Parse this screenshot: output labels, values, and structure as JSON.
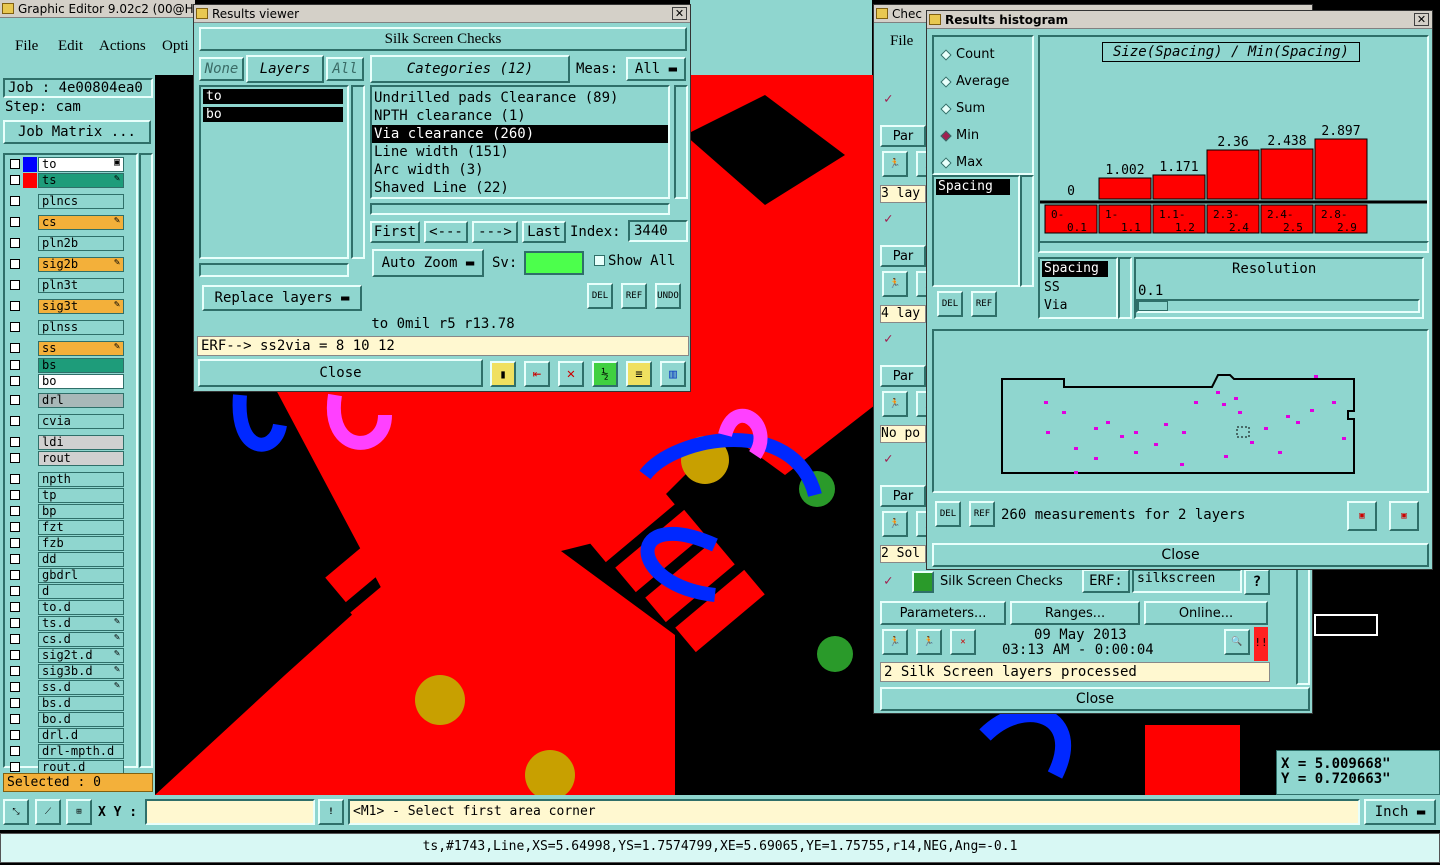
{
  "main_window": {
    "title": "Graphic Editor 9.02c2 (00@HY-",
    "menu": [
      "File",
      "Edit",
      "Actions",
      "Opti"
    ],
    "job_label": "Job : 4e00804ea0",
    "step_label": "Step: cam",
    "job_matrix_button": "Job Matrix ...",
    "selected_label": "Selected : 0",
    "layers": [
      {
        "name": "to",
        "color": "#ffffff",
        "swatch": "#0000ff",
        "mark": "▣"
      },
      {
        "name": "ts",
        "color": "#1e9c7a",
        "swatch": "#ff0000",
        "mark": "✎"
      },
      {
        "name": "plncs",
        "color": "#8fd6cf",
        "swatch": "",
        "mark": ""
      },
      {
        "name": "cs",
        "color": "#f3b03a",
        "swatch": "",
        "mark": "✎"
      },
      {
        "name": "pln2b",
        "color": "#8fd6cf",
        "swatch": "",
        "mark": ""
      },
      {
        "name": "sig2b",
        "color": "#f3b03a",
        "swatch": "",
        "mark": "✎"
      },
      {
        "name": "pln3t",
        "color": "#8fd6cf",
        "swatch": "",
        "mark": ""
      },
      {
        "name": "sig3t",
        "color": "#f3b03a",
        "swatch": "",
        "mark": "✎"
      },
      {
        "name": "plnss",
        "color": "#8fd6cf",
        "swatch": "",
        "mark": ""
      },
      {
        "name": "ss",
        "color": "#f3b03a",
        "swatch": "",
        "mark": "✎"
      },
      {
        "name": "bs",
        "color": "#1e9c7a",
        "swatch": "",
        "mark": ""
      },
      {
        "name": "bo",
        "color": "#ffffff",
        "swatch": "",
        "mark": ""
      },
      {
        "name": "drl",
        "color": "#a8b8b8",
        "swatch": "",
        "mark": ""
      },
      {
        "name": "cvia",
        "color": "#8fd6cf",
        "swatch": "",
        "mark": ""
      },
      {
        "name": "ldi",
        "color": "#d0d0d0",
        "swatch": "",
        "mark": ""
      },
      {
        "name": "rout",
        "color": "#d0d0d0",
        "swatch": "",
        "mark": ""
      },
      {
        "name": "npth",
        "color": "#8fd6cf",
        "swatch": "",
        "mark": ""
      },
      {
        "name": "tp",
        "color": "#8fd6cf",
        "swatch": "",
        "mark": ""
      },
      {
        "name": "bp",
        "color": "#8fd6cf",
        "swatch": "",
        "mark": ""
      },
      {
        "name": "fzt",
        "color": "#8fd6cf",
        "swatch": "",
        "mark": ""
      },
      {
        "name": "fzb",
        "color": "#8fd6cf",
        "swatch": "",
        "mark": ""
      },
      {
        "name": "dd",
        "color": "#8fd6cf",
        "swatch": "",
        "mark": ""
      },
      {
        "name": "gbdrl",
        "color": "#8fd6cf",
        "swatch": "",
        "mark": ""
      },
      {
        "name": "d",
        "color": "#8fd6cf",
        "swatch": "",
        "mark": ""
      },
      {
        "name": "to.d",
        "color": "#8fd6cf",
        "swatch": "",
        "mark": ""
      },
      {
        "name": "ts.d",
        "color": "#8fd6cf",
        "swatch": "",
        "mark": "✎"
      },
      {
        "name": "cs.d",
        "color": "#8fd6cf",
        "swatch": "",
        "mark": "✎"
      },
      {
        "name": "sig2t.d",
        "color": "#8fd6cf",
        "swatch": "",
        "mark": "✎"
      },
      {
        "name": "sig3b.d",
        "color": "#8fd6cf",
        "swatch": "",
        "mark": "✎"
      },
      {
        "name": "ss.d",
        "color": "#8fd6cf",
        "swatch": "",
        "mark": "✎"
      },
      {
        "name": "bs.d",
        "color": "#8fd6cf",
        "swatch": "",
        "mark": ""
      },
      {
        "name": "bo.d",
        "color": "#8fd6cf",
        "swatch": "",
        "mark": ""
      },
      {
        "name": "drl.d",
        "color": "#8fd6cf",
        "swatch": "",
        "mark": ""
      },
      {
        "name": "drl-mpth.d",
        "color": "#8fd6cf",
        "swatch": "",
        "mark": ""
      },
      {
        "name": "rout.d",
        "color": "#8fd6cf",
        "swatch": "",
        "mark": ""
      }
    ],
    "xy_label": "X Y :",
    "prompt": "<M1> - Select first area corner",
    "units": "Inch",
    "status_line": "ts,#1743,Line,XS=5.64998,YS=1.7574799,XE=5.69065,YE=1.75755,r14,NEG,Ang=-0.1",
    "coord_x": "X  =  5.009668\"",
    "coord_y": "Y  =  0.720663\""
  },
  "results_viewer": {
    "title": "Results viewer",
    "header": "Silk Screen Checks",
    "none_btn": "None",
    "layers_btn": "Layers",
    "all_btn": "All",
    "layer_list": [
      "to",
      "bo"
    ],
    "categories_btn": "Categories (12)",
    "meas_label": "Meas:",
    "meas_value": "All",
    "categories": [
      "Undrilled pads Clearance (89)",
      "NPTH clearance (1)",
      "Via clearance (260)",
      "Line width (151)",
      "Arc width (3)",
      "Shaved Line (22)"
    ],
    "selected_category": 2,
    "first_btn": "First",
    "prev_btn": "<---",
    "next_btn": "--->",
    "last_btn": "Last",
    "index_label": "Index:",
    "index_value": "3440",
    "auto_zoom": "Auto Zoom",
    "sv_label": "Sv:",
    "show_all": "Show All",
    "replace_layers": "Replace layers",
    "del": "DEL",
    "ref": "REF",
    "undo": "UNDO",
    "info_line": "to  0mil   r5   r13.78",
    "erf_line": "ERF--> ss2via = 8 10 12",
    "close": "Close"
  },
  "checks_window": {
    "title": "Chec",
    "file_menu": "File",
    "rows": [
      {
        "par": "Par",
        "note": "3 lay"
      },
      {
        "par": "Par",
        "note": "4 lay"
      },
      {
        "par": "Par",
        "note": "No po"
      },
      {
        "par": "Par",
        "note": "2 Sol"
      }
    ],
    "silk_label": "Silk Screen Checks",
    "erf_label": "ERF:",
    "erf_value": "silkscreen",
    "help": "?",
    "parameters": "Parameters...",
    "ranges": "Ranges...",
    "online": "Online...",
    "date": "09 May 2013",
    "time": "03:13 AM - 0:00:04",
    "status": "2 Silk Screen layers processed",
    "close": "Close"
  },
  "histogram": {
    "title": "Results histogram",
    "modes": [
      "Count",
      "Average",
      "Sum",
      "Min",
      "Max"
    ],
    "selected_mode": 3,
    "chart_title": "Size(Spacing) / Min(Spacing)",
    "measure_list": [
      "Spacing"
    ],
    "bins": [
      {
        "label": "0-\n0.1",
        "value": 0,
        "text": "0"
      },
      {
        "label": "1-\n1.1",
        "value": 1.002,
        "text": "1.002"
      },
      {
        "label": "1.1-\n1.2",
        "value": 1.171,
        "text": "1.171"
      },
      {
        "label": "2.3-\n2.4",
        "value": 2.36,
        "text": "2.36"
      },
      {
        "label": "2.4-\n2.5",
        "value": 2.438,
        "text": "2.438"
      },
      {
        "label": "2.8-\n2.9",
        "value": 2.897,
        "text": "2.897"
      }
    ],
    "types": [
      "Spacing",
      "SS",
      "Via"
    ],
    "resolution_label": "Resolution",
    "resolution_value": "0.1",
    "summary": "260 measurements for 2 layers",
    "del": "DEL",
    "ref": "REF",
    "close": "Close"
  }
}
